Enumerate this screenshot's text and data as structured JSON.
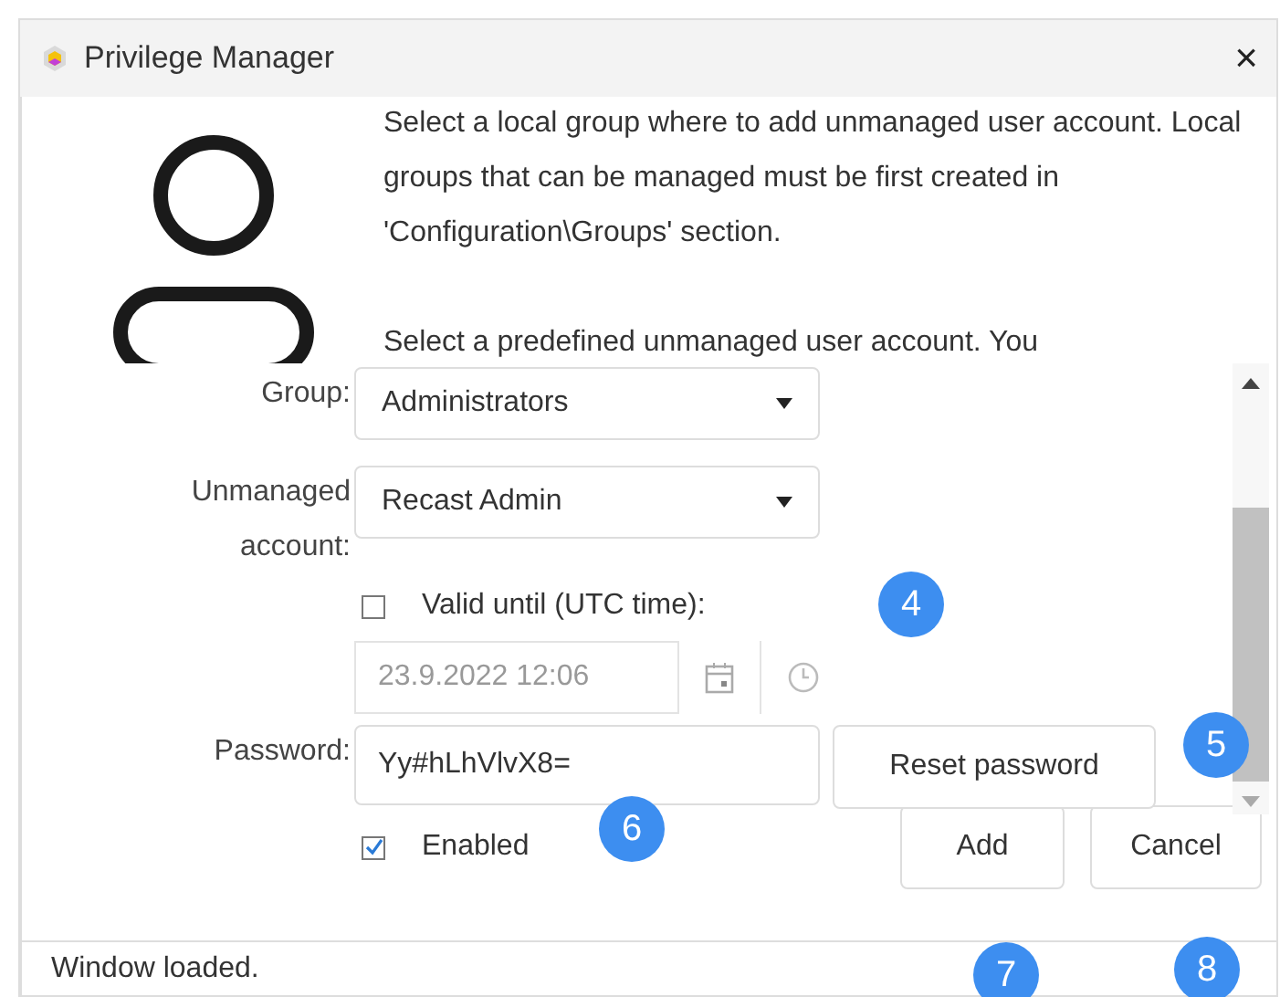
{
  "window": {
    "title": "Privilege Manager",
    "close": "×"
  },
  "description": [
    "Select a local group where to add unmanaged user account. Local groups that can be managed must be first created in 'Configuration\\Groups' section.",
    "Select a predefined unmanaged user account. You"
  ],
  "form": {
    "group": {
      "label": "Group:",
      "value": "Administrators"
    },
    "account": {
      "label": "Unmanaged account:",
      "value": "Recast Admin"
    },
    "valid_until": {
      "label": "Valid until (UTC time):",
      "checked": false,
      "value": "23.9.2022 12:06",
      "disabled": true
    },
    "password": {
      "label": "Password:",
      "value": "Yy#hLhVlvX8=",
      "reset": "Reset password"
    },
    "enabled": {
      "label": "Enabled",
      "checked": true
    }
  },
  "buttons": [
    "Add",
    "Cancel"
  ],
  "status_bar": "Window loaded.",
  "callouts": [
    {
      "number": "4"
    },
    {
      "number": "5"
    },
    {
      "number": "6"
    },
    {
      "number": "7"
    },
    {
      "number": "8"
    }
  ]
}
